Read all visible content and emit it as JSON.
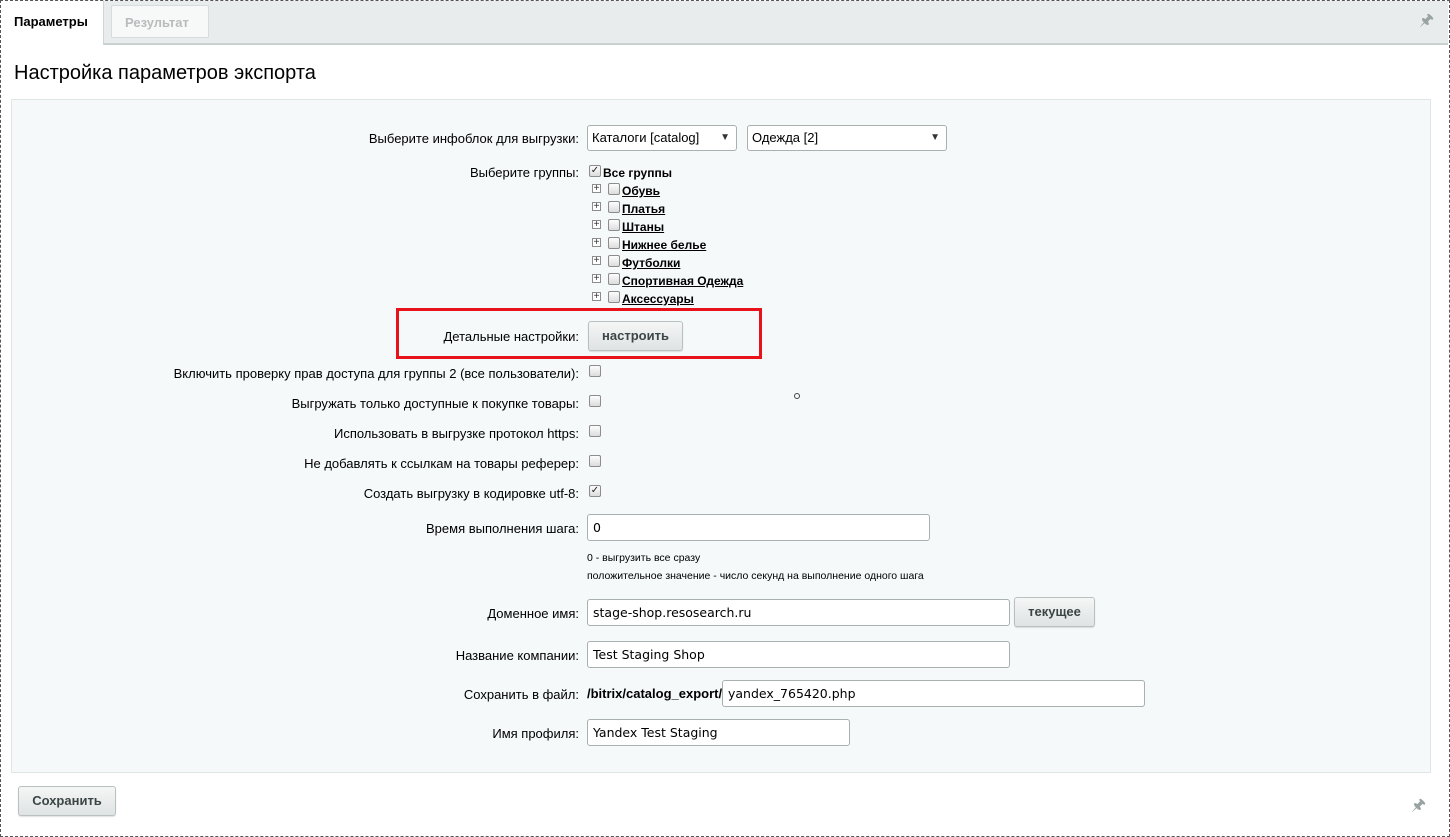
{
  "tabs": [
    {
      "label": "Параметры"
    },
    {
      "label": "Результат"
    }
  ],
  "page_title": "Настройка параметров экспорта",
  "infoblock": {
    "label": "Выберите инфоблок для выгрузки:",
    "type_select": "Каталоги [catalog]",
    "iblock_select": "Одежда [2]"
  },
  "groups": {
    "label": "Выберите группы:",
    "all_label": "Все группы",
    "all_checked": true,
    "items": [
      {
        "label": "Обувь"
      },
      {
        "label": "Платья"
      },
      {
        "label": "Штаны"
      },
      {
        "label": "Нижнее белье"
      },
      {
        "label": "Футболки"
      },
      {
        "label": "Спортивная Одежда"
      },
      {
        "label": "Аксессуары"
      }
    ]
  },
  "detail": {
    "label": "Детальные настройки:",
    "button": "настроить"
  },
  "options": [
    {
      "label": "Включить проверку прав доступа для группы 2 (все пользователи):",
      "checked": false
    },
    {
      "label": "Выгружать только доступные к покупке товары:",
      "checked": false
    },
    {
      "label": "Использовать в выгрузке протокол https:",
      "checked": false
    },
    {
      "label": "Не добавлять к ссылкам на товары реферер:",
      "checked": false
    },
    {
      "label": "Создать выгрузку в кодировке utf-8:",
      "checked": true
    }
  ],
  "step_time": {
    "label": "Время выполнения шага:",
    "value": "0",
    "hint1": "0 - выгрузить все сразу",
    "hint2": "положительное значение - число секунд на выполнение одного шага"
  },
  "domain": {
    "label": "Доменное имя:",
    "value": "stage-shop.resosearch.ru",
    "button": "текущее"
  },
  "company": {
    "label": "Название компании:",
    "value": "Test Staging Shop"
  },
  "save_file": {
    "label": "Сохранить в файл:",
    "path": "/bitrix/catalog_export/",
    "value": "yandex_765420.php"
  },
  "profile": {
    "label": "Имя профиля:",
    "value": "Yandex Test Staging"
  },
  "footer": {
    "save_button": "Сохранить"
  },
  "colors": {
    "highlight": "#e8121a",
    "panel_bg": "#f5f9f9",
    "tabbar_bg": "#e8ecec"
  }
}
